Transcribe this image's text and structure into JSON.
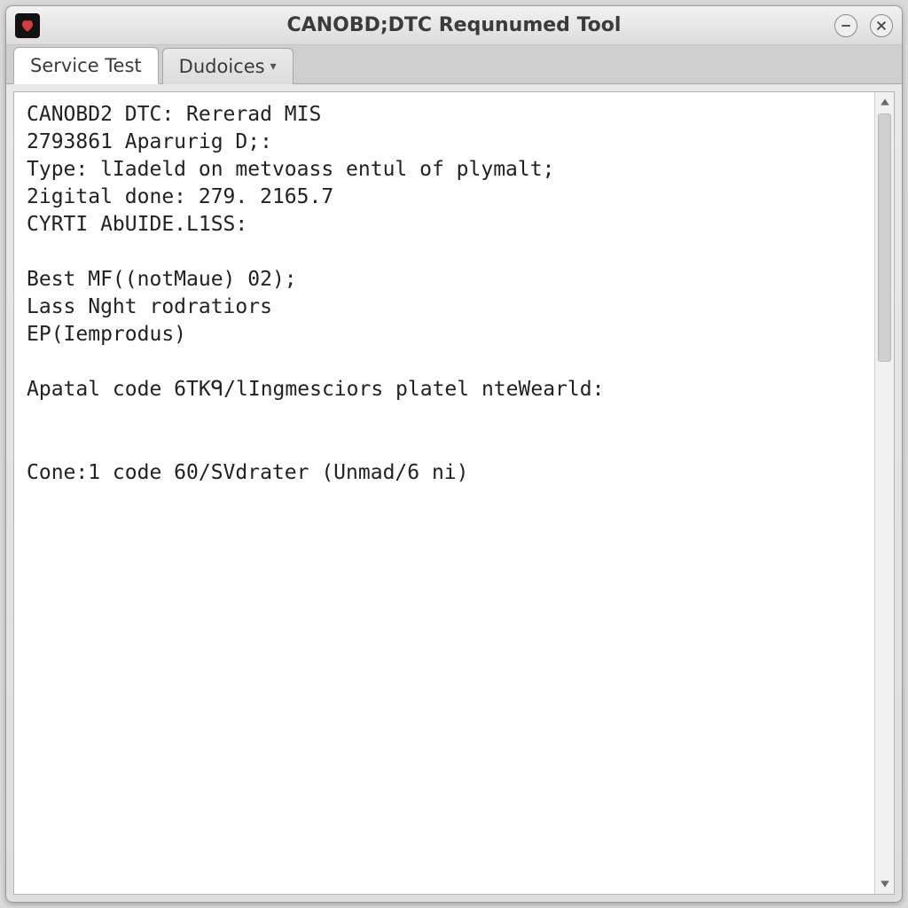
{
  "window": {
    "title": "CANOBD;DTC Requnumed Tool"
  },
  "tabs": [
    {
      "label": "Service Test",
      "active": true,
      "has_dropdown": false
    },
    {
      "label": "Dudoices",
      "active": false,
      "has_dropdown": true
    }
  ],
  "output_lines": [
    "CANOBD2 DTC: Rererad MIS",
    "2793861 Aparurig D;:",
    "Type: lIadeld on metvoass entul of plymalt;",
    "2igital done: 279. 2165.7",
    "CYRTI AbUIDE.L1SS:",
    "",
    "Best MF((notMaue) 02);",
    "Lass Nght rodratiors",
    "EP(Iemprodus)",
    "",
    "Apatal code 6TKᑫ/lIngmesciors platel nteWearld:",
    "",
    "",
    "Cone:1 code 60/SVdrater (Unmad/6 ni)"
  ]
}
